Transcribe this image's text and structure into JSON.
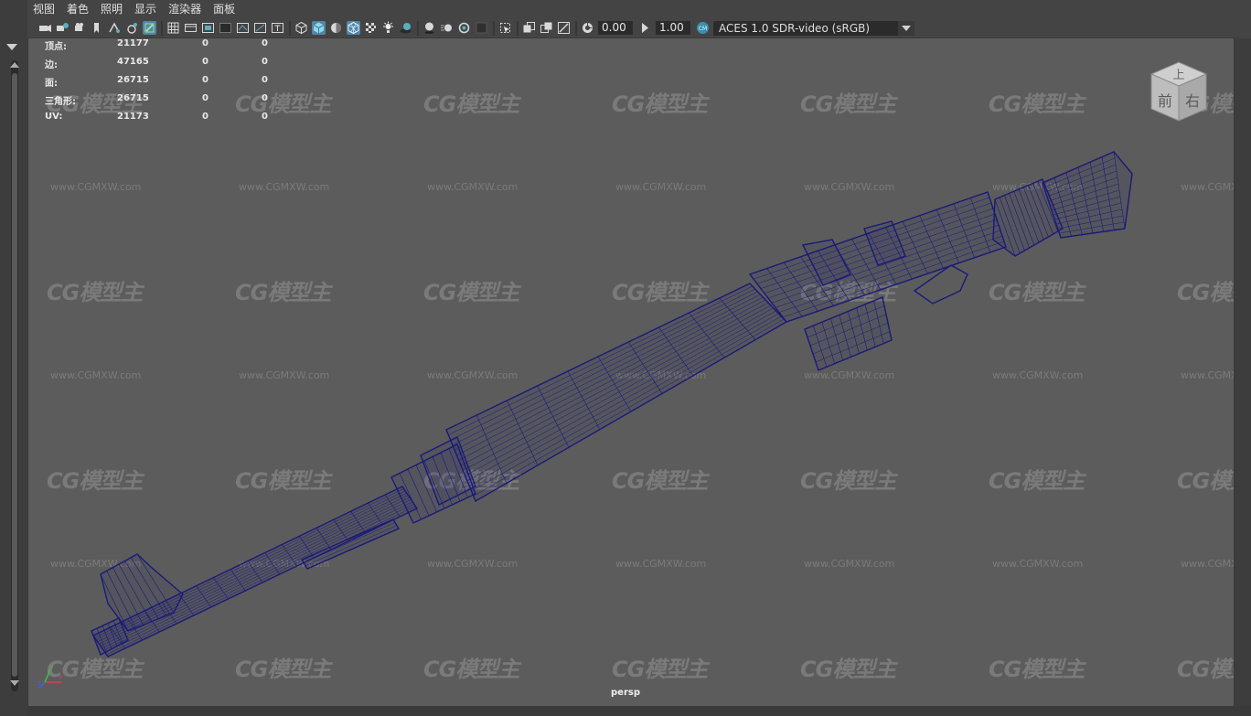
{
  "menu": {
    "items": [
      "视图",
      "着色",
      "照明",
      "显示",
      "渲染器",
      "面板"
    ]
  },
  "toolbar": {
    "exposure_value": "0.00",
    "gamma_value": "1.00",
    "color_space": "ACES 1.0 SDR-video (sRGB)"
  },
  "hud": {
    "rows": [
      {
        "label": "顶点:",
        "v1": "21177",
        "v2": "0",
        "v3": "0"
      },
      {
        "label": "边:",
        "v1": "47165",
        "v2": "0",
        "v3": "0"
      },
      {
        "label": "面:",
        "v1": "26715",
        "v2": "0",
        "v3": "0"
      },
      {
        "label": "三角形:",
        "v1": "26715",
        "v2": "0",
        "v3": "0"
      },
      {
        "label": "UV:",
        "v1": "21173",
        "v2": "0",
        "v3": "0"
      }
    ]
  },
  "viewport": {
    "camera_label": "persp",
    "viewcube_top": "上",
    "viewcube_front": "前",
    "viewcube_right": "右"
  },
  "watermark": {
    "logo_text": "CG模型主",
    "url_text": "www.CGMXW.com"
  },
  "colors": {
    "viewport_bg": "#5c5c5c",
    "wireframe": "#1a1a7a",
    "ui_bg": "#444444",
    "accent": "#5285a6"
  }
}
